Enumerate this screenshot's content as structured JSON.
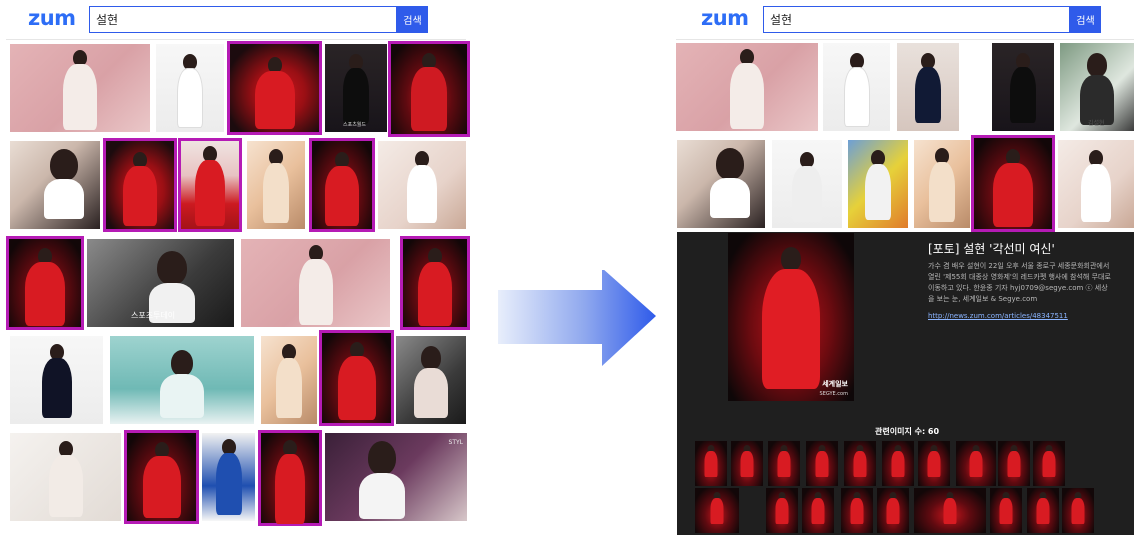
{
  "left": {
    "logo": "zum",
    "search_value": "설현",
    "search_button": "검색",
    "watermarks": {
      "img_r1c4": "스포츠월드",
      "img_r3c2": "스포츠투데이",
      "img_r5c5": "STYL"
    }
  },
  "right": {
    "logo": "zum",
    "search_value": "설현",
    "search_button": "검색",
    "watermark_r1c5": "김설현",
    "detail": {
      "title": "[포토] 설현 '각선미 여신'",
      "body": "가수 겸 배우 설현이 22일 오후 서울 종로구 세종문화회관에서 열린 '제55회 대종상 영화제'의 레드카펫 행사에 참석해 무대로 이동하고 있다. 한윤종 기자 hyj0709@segye.com ⓒ 세상을 보는 눈, 세계일보 & Segye.com",
      "link": "http://news.zum.com/articles/48347511",
      "photo_watermark": "세계일보",
      "photo_watermark_sub": "SEGYE.com",
      "related_label": "관련이미지 수: 60"
    }
  },
  "colors": {
    "brand": "#2d6df6",
    "search_button": "#2f5bea",
    "selection": "#b51bb5",
    "detail_bg": "#1f1f1f"
  },
  "icons": [
    "arrow-right-icon"
  ]
}
